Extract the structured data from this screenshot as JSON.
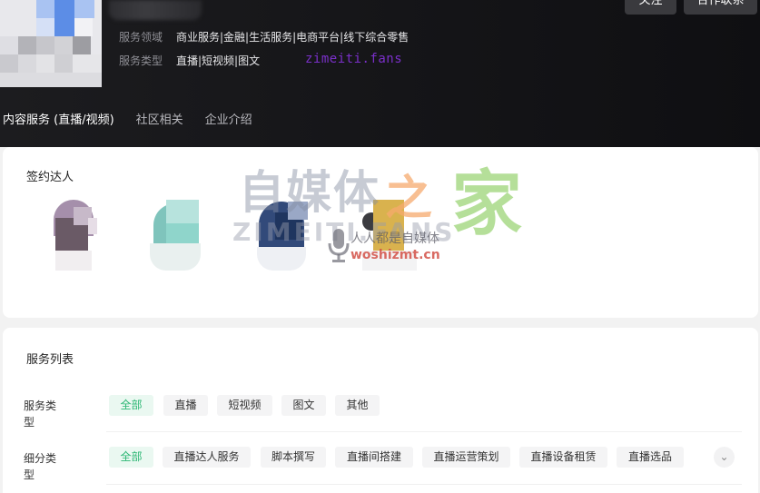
{
  "header": {
    "follow_label": "关注",
    "contact_label": "合作联系",
    "service_domain_label": "服务领域",
    "service_domain_value": "商业服务|金融|生活服务|电商平台|线下综合零售",
    "service_type_label": "服务类型",
    "service_type_value": "直播|短视频|图文",
    "watermark": "zimeiti.fans"
  },
  "tabs": [
    {
      "label": "内容服务 (直播/视频)",
      "active": true
    },
    {
      "label": "社区相关",
      "active": false
    },
    {
      "label": "企业介绍",
      "active": false
    }
  ],
  "talents": {
    "title": "签约达人"
  },
  "watermark": {
    "main": "自媒体",
    "zhi": "之",
    "jia": "家",
    "sub": "ZIMEITI.FANS",
    "mid": "人人都是自媒体",
    "url": "woshizmt.cn"
  },
  "service_list": {
    "title": "服务列表",
    "service_type_label": "服务类型",
    "service_type_options": [
      "全部",
      "直播",
      "短视频",
      "图文",
      "其他"
    ],
    "sub_type_label": "细分类型",
    "sub_type_options": [
      "全部",
      "直播达人服务",
      "脚本撰写",
      "直播间搭建",
      "直播运营策划",
      "直播设备租赁",
      "直播选品"
    ]
  },
  "colors": {
    "accent_green": "#2bb673",
    "watermark_purple": "#7a2fc9",
    "header_bg": "#141417"
  },
  "icons": {
    "expand": "chevron-down-icon",
    "watermark_mic": "microphone-icon"
  }
}
